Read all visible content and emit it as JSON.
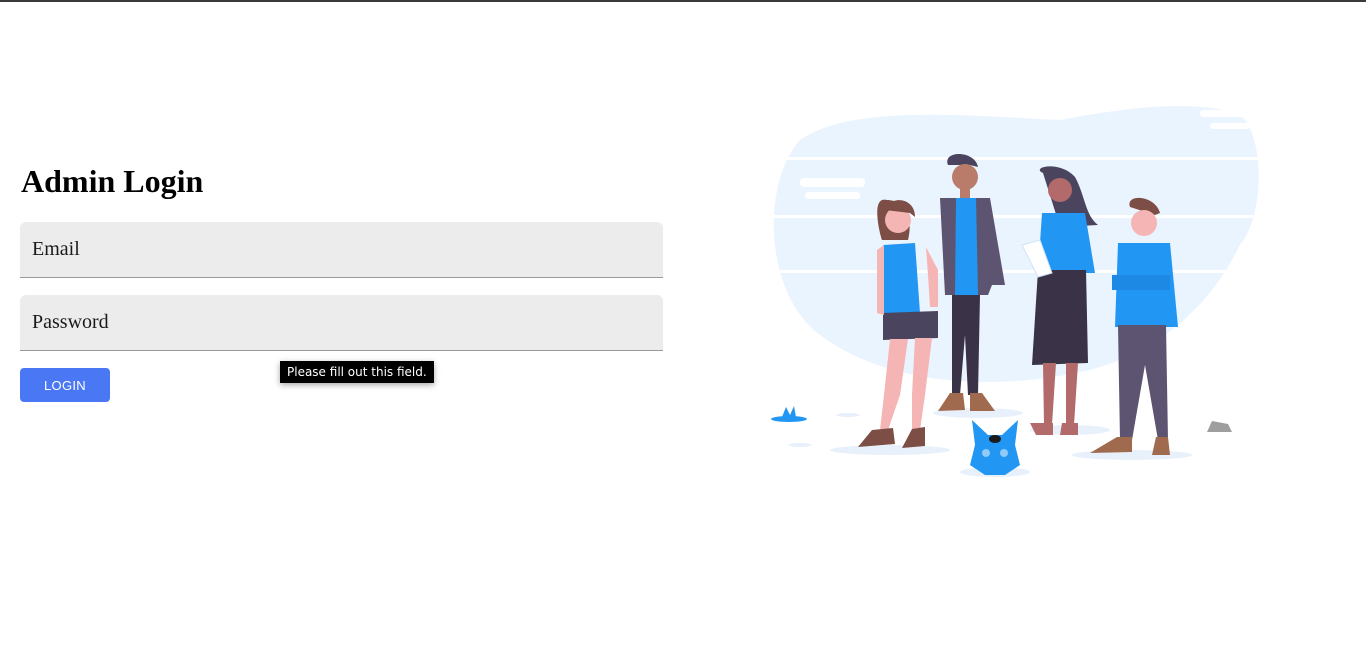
{
  "login": {
    "heading": "Admin Login",
    "email_placeholder": "Email",
    "password_placeholder": "Password",
    "submit_label": "LOGIN"
  },
  "validation_tooltip": {
    "message": "Please fill out this field."
  },
  "colors": {
    "primary_button": "#4a78f5",
    "field_background": "#ececec",
    "illustration_accent": "#2196f3",
    "illustration_backdrop": "#eaf4fe"
  },
  "illustration": {
    "icon": "team-people-illustration"
  }
}
